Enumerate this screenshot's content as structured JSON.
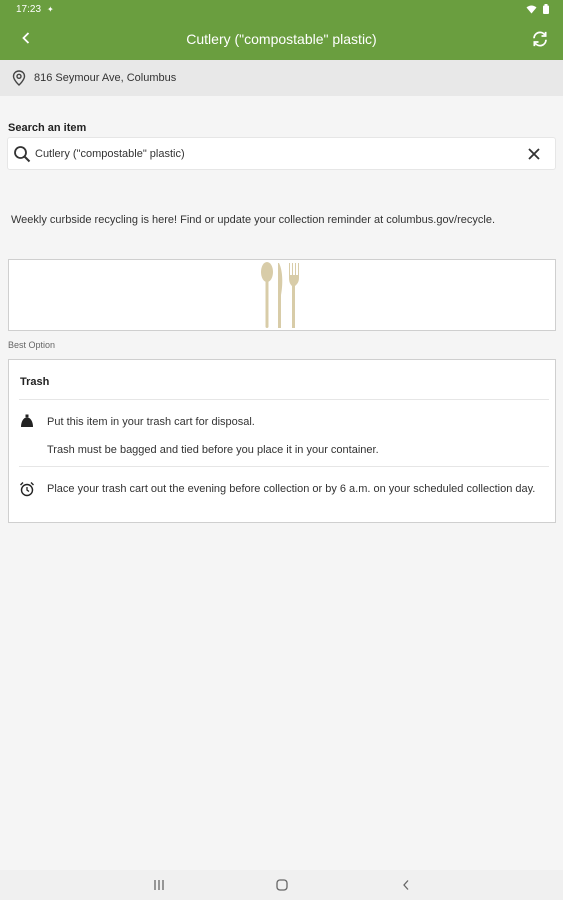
{
  "status_bar": {
    "time": "17:23"
  },
  "app_bar": {
    "title": "Cutlery (\"compostable\" plastic)"
  },
  "location": {
    "address": "816 Seymour Ave, Columbus"
  },
  "search": {
    "label": "Search an item",
    "value": "Cutlery (\"compostable\" plastic)"
  },
  "notice": {
    "text": "Weekly curbside recycling is here! Find or update your collection reminder at columbus.gov/recycle."
  },
  "best_option": {
    "label": "Best Option"
  },
  "card": {
    "title": "Trash",
    "line1": "Put this item in your trash cart for disposal.",
    "line2": "Trash must be bagged and tied before you place it in your container.",
    "line3": "Place your trash cart out the evening before collection or by 6 a.m. on your scheduled collection day."
  },
  "colors": {
    "brand": "#6a9e3f",
    "cutlery": "#d8cca8"
  }
}
